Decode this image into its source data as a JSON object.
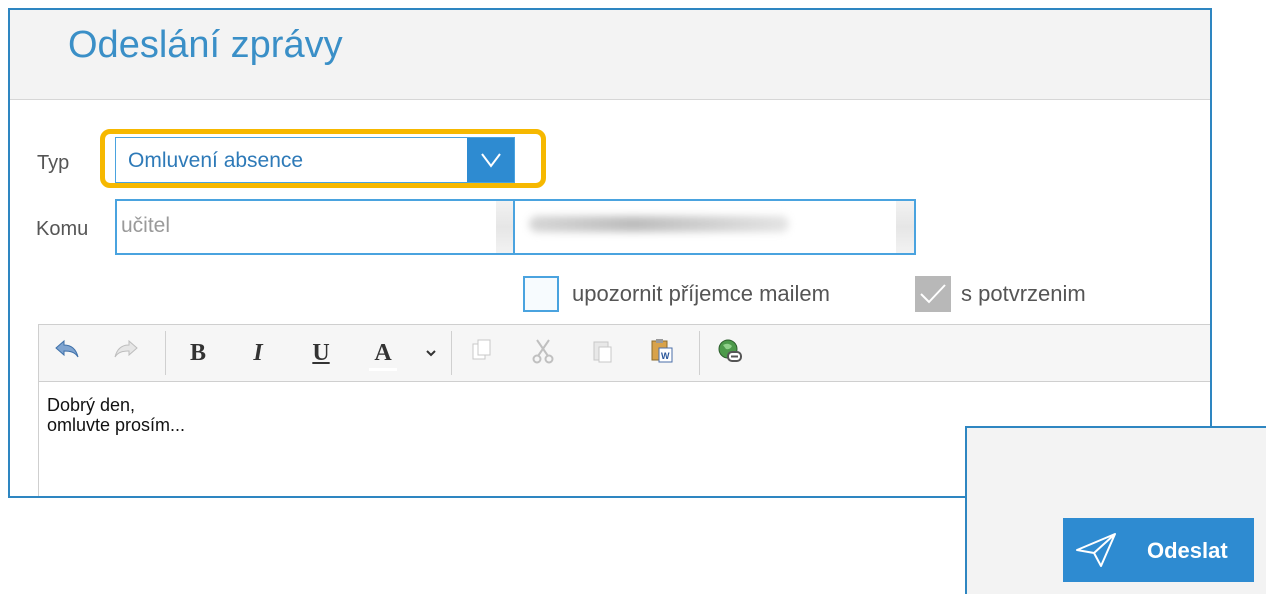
{
  "dialog": {
    "title": "Odeslání zprávy"
  },
  "form": {
    "type_label": "Typ",
    "type_value": "Omluvení absence",
    "to_label": "Komu",
    "to_role_value": "učitel",
    "to_person_value": ""
  },
  "options": {
    "notify_label": "upozornit příjemce mailem",
    "notify_checked": false,
    "confirm_label": "s potvrzenim",
    "confirm_checked": true
  },
  "toolbar": {
    "buttons": [
      "undo-icon",
      "redo-icon",
      "bold",
      "italic",
      "underline",
      "font-color",
      "dropdown",
      "copy",
      "cut",
      "paste",
      "paste-word",
      "link"
    ],
    "bold": "B",
    "italic": "I",
    "underline": "U",
    "font_color": "A"
  },
  "editor": {
    "line1": "Dobrý den,",
    "line2": "omluvte prosím..."
  },
  "send": {
    "label": "Odeslat"
  },
  "colors": {
    "accent": "#2e8bd1",
    "highlight": "#f6b800"
  }
}
